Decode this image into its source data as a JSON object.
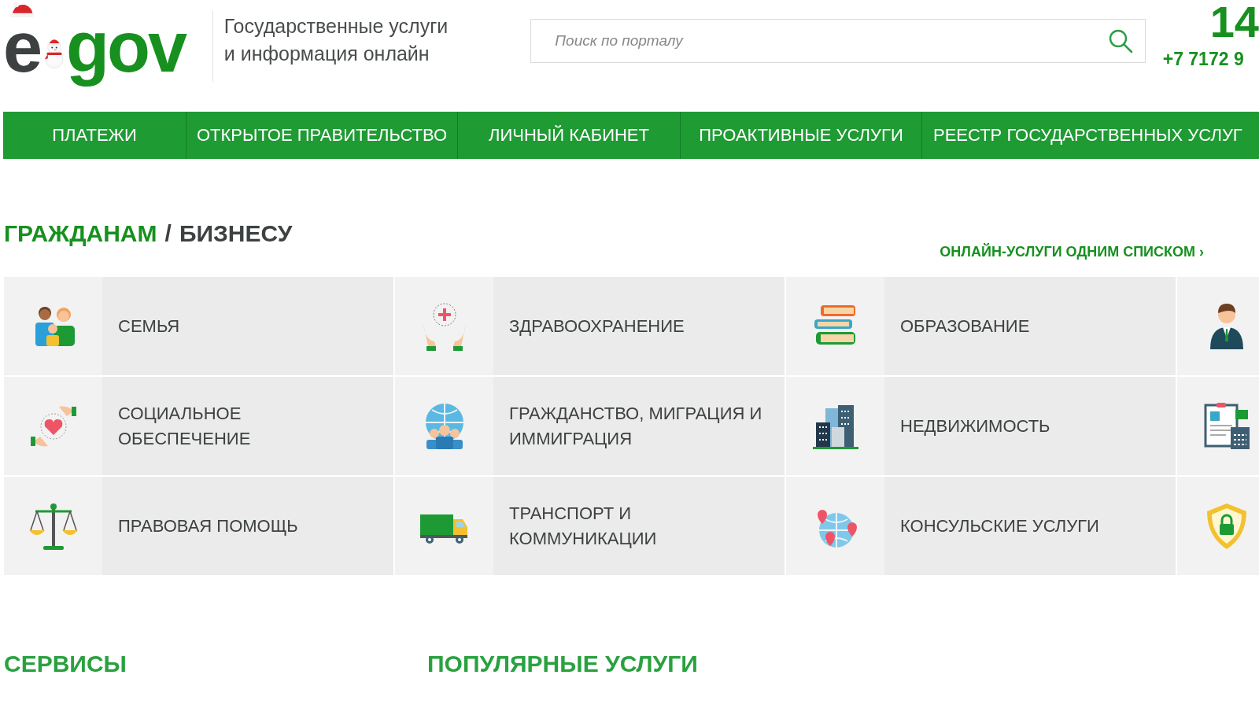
{
  "logo": {
    "first": "e",
    "rest": "gov"
  },
  "tagline": "Государственные услуги и информация онлайн",
  "search": {
    "placeholder": "Поиск по порталу"
  },
  "contact": {
    "short_number": "14",
    "phone": "+7 7172 9"
  },
  "nav": [
    "ПЛАТЕЖИ",
    "ОТКРЫТОЕ ПРАВИТЕЛЬСТВО",
    "ЛИЧНЫЙ КАБИНЕТ",
    "ПРОАКТИВНЫЕ УСЛУГИ",
    "РЕЕСТР ГОСУДАРСТВЕННЫХ УСЛУГ"
  ],
  "section": {
    "title_primary": "ГРАЖДАНАМ",
    "separator": "/",
    "title_secondary": "БИЗНЕСУ",
    "all_services_link": "ОНЛАЙН-УСЛУГИ ОДНИМ СПИСКОМ ›"
  },
  "categories": [
    {
      "kind": "labeled",
      "label": "СЕМЬЯ"
    },
    {
      "kind": "labeled",
      "label": "ЗДРАВООХРАНЕНИЕ"
    },
    {
      "kind": "labeled",
      "label": "ОБРАЗОВАНИЕ"
    },
    {
      "kind": "icon_only"
    },
    {
      "kind": "labeled",
      "label": "СОЦИАЛЬНОЕ ОБЕСПЕЧЕНИЕ"
    },
    {
      "kind": "labeled",
      "label": "ГРАЖДАНСТВО, МИГРАЦИЯ И ИММИГРАЦИЯ"
    },
    {
      "kind": "labeled",
      "label": "НЕДВИЖИМОСТЬ"
    },
    {
      "kind": "icon_only"
    },
    {
      "kind": "labeled",
      "label": "ПРАВОВАЯ ПОМОЩЬ"
    },
    {
      "kind": "labeled",
      "label": "ТРАНСПОРТ И КОММУНИКАЦИИ"
    },
    {
      "kind": "labeled",
      "label": "КОНСУЛЬСКИЕ УСЛУГИ"
    },
    {
      "kind": "icon_only"
    }
  ],
  "bottom_headings": [
    "СЕРВИСЫ",
    "ПОПУЛЯРНЫЕ УСЛУГИ"
  ]
}
